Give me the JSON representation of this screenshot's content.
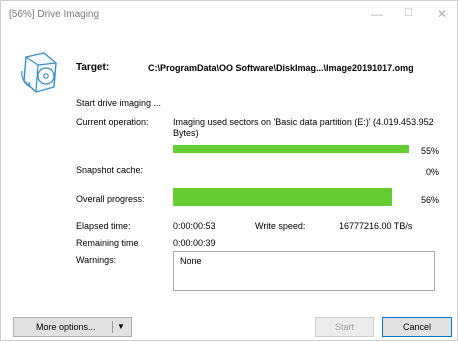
{
  "window": {
    "title": "[56%] Drive Imaging"
  },
  "icons": {
    "disk": "disk-icon",
    "minimize": "minimize-icon",
    "maximize": "maximize-icon",
    "close": "close-icon",
    "dropdown": "chevron-down-icon"
  },
  "target": {
    "label": "Target:",
    "value": "C:\\ProgramData\\OO Software\\DiskImag...\\Image20191017.omg"
  },
  "status": {
    "start_text": "Start drive imaging ...",
    "current_operation_label": "Current operation:",
    "current_operation_value": "Imaging used sectors on 'Basic data partition (E:)' (4.019.453.952 Bytes)",
    "operation_progress": "55%",
    "operation_progress_fraction": 0.55,
    "snapshot_cache_label": "Snapshot cache:",
    "snapshot_cache_value": "0%",
    "overall_progress_label": "Overall progress:",
    "overall_progress_value": "56%",
    "overall_progress_fraction": 0.56,
    "elapsed_label": "Elapsed time:",
    "elapsed_value": "0:00:00:53",
    "remaining_label": "Remaining time",
    "remaining_value": "0:00:00:39",
    "write_speed_label": "Write speed:",
    "write_speed_value": "16777216.00 TB/s",
    "warnings_label": "Warnings:",
    "warnings_value": "None"
  },
  "buttons": {
    "more_options": "More options...",
    "start": "Start",
    "cancel": "Cancel"
  },
  "colors": {
    "progress_fill": "#66cc33",
    "title_text": "#7a7a7a",
    "focus_border": "#0078d7"
  }
}
